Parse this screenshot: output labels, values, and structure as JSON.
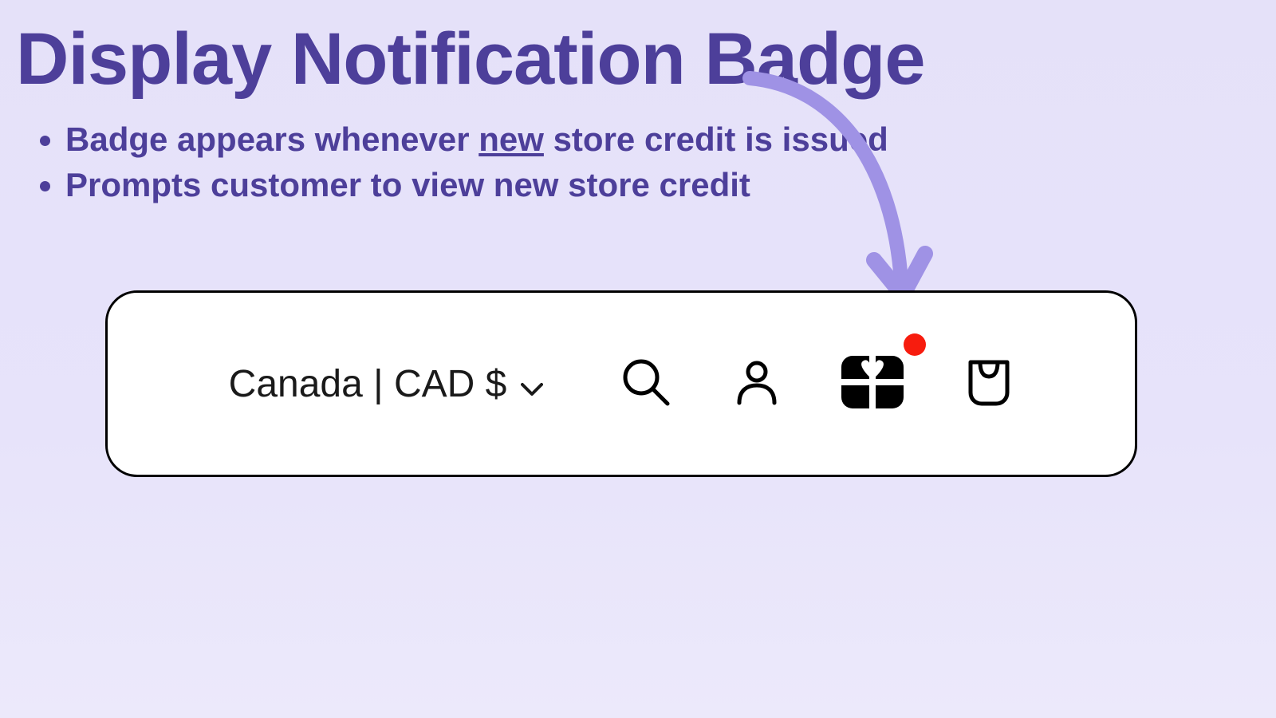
{
  "slide": {
    "title": "Display Notification Badge",
    "bullet1_pre": "Badge appears whenever ",
    "bullet1_underlined": "new",
    "bullet1_post": " store credit is issued",
    "bullet2": "Prompts customer to view new store credit"
  },
  "navbar": {
    "currency_label": "Canada | CAD $"
  },
  "colors": {
    "accent": "#4d3f9a",
    "arrow": "#9f92e5",
    "badge": "#f71c0e"
  }
}
